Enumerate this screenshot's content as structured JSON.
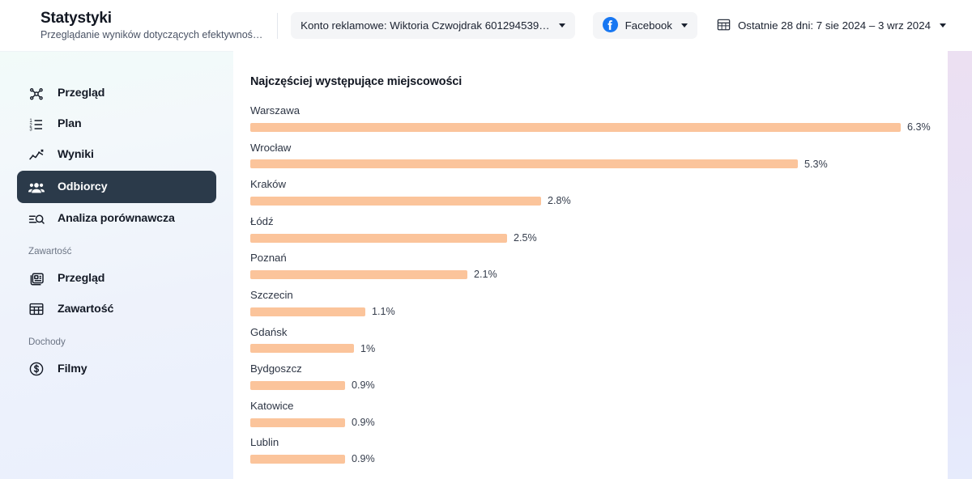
{
  "header": {
    "title": "Statystyki",
    "subtitle": "Przeglądanie wyników dotyczących efektywnoś…",
    "account_label": "Konto reklamowe: Wiktoria Czwojdrak 601294539…",
    "platform_label": "Facebook",
    "date_range_label": "Ostatnie 28 dni: 7 sie 2024 – 3 wrz 2024",
    "facebook_blue": "#1877F2"
  },
  "sidebar": {
    "items": [
      {
        "label": "Przegląd",
        "icon": "network-nodes-icon",
        "active": false
      },
      {
        "label": "Plan",
        "icon": "numbered-list-icon",
        "active": false
      },
      {
        "label": "Wyniki",
        "icon": "line-chart-icon",
        "active": false
      },
      {
        "label": "Odbiorcy",
        "icon": "people-group-icon",
        "active": true
      },
      {
        "label": "Analiza porównawcza",
        "icon": "search-compare-icon",
        "active": false
      }
    ],
    "sections": [
      {
        "label": "Zawartość",
        "items": [
          {
            "label": "Przegląd",
            "icon": "content-cards-icon"
          },
          {
            "label": "Zawartość",
            "icon": "table-grid-icon"
          }
        ]
      },
      {
        "label": "Dochody",
        "items": [
          {
            "label": "Filmy",
            "icon": "dollar-circle-icon"
          }
        ]
      }
    ],
    "active_bg": "#2b3a4a"
  },
  "main": {
    "panel_title": "Najczęściej występujące miejscowości"
  },
  "chart_data": {
    "type": "bar",
    "orientation": "horizontal",
    "title": "Najczęściej występujące miejscowości",
    "xlabel": "",
    "ylabel": "",
    "unit": "%",
    "bar_color": "#fbc49b",
    "max_value": 6.3,
    "categories": [
      "Warszawa",
      "Wrocław",
      "Kraków",
      "Łódź",
      "Poznań",
      "Szczecin",
      "Gdańsk",
      "Bydgoszcz",
      "Katowice",
      "Lublin"
    ],
    "values": [
      6.3,
      5.3,
      2.8,
      2.5,
      2.1,
      1.1,
      1.0,
      0.9,
      0.9,
      0.9
    ],
    "value_labels": [
      "6.3%",
      "5.3%",
      "2.8%",
      "2.5%",
      "2.1%",
      "1.1%",
      "1%",
      "0.9%",
      "0.9%",
      "0.9%"
    ],
    "bar_pixel_widths": [
      803,
      676,
      359,
      317,
      268,
      142,
      128,
      117,
      117,
      117
    ]
  }
}
